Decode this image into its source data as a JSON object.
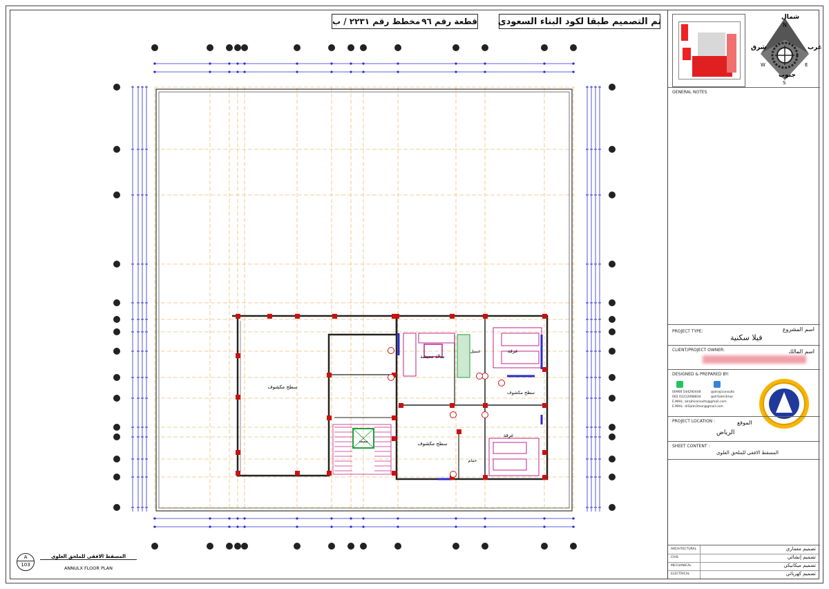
{
  "title_bar": {
    "code_text": "تم التصميم طبقا لكود البناء السعودى",
    "plot_text": "قطعة رقم ٩٦",
    "scheme_text": "مخطط رقم ٢٢٣١ / ب"
  },
  "compass": {
    "north_ar": "شمال",
    "east_ar": "شرق",
    "west_ar": "غرب",
    "south_ar": "جنوب",
    "n": "N",
    "e": "E",
    "w": "W",
    "s": "S"
  },
  "panel": {
    "general_notes": "GENERAL NOTES",
    "project_type_label": "PROJECT TYPE:",
    "project_type_ar_label": "اسم المشروع",
    "project_type_value": "فيلا سكنية",
    "owner_label": "CLIENT/PROJECT OWNER:",
    "owner_ar_label": "اسم المالك",
    "designed_label": "DESIGNED & PREPARED BY:",
    "contacts": [
      "00966 544292448",
      "002 01212068834",
      "E.MAIL: alrajhiconsults@gmail.com",
      "E.MAIL: drSalm3mar@gmail.com"
    ],
    "socials": [
      "@alrajiconsults",
      "@drSalm3mar"
    ],
    "location_label": "PROJECT LOCATION :",
    "location_ar_label": "الموقع",
    "location_value": "الرياض",
    "sheet_label": "SHEET CONTENT :",
    "sheet_value": "المسقط الافقى للملحق العلوى",
    "disciplines": [
      {
        "en": "ARCHITECTURAL",
        "ar": "تصميم معماري"
      },
      {
        "en": "CIVIL",
        "ar": "تصميم إنشائي"
      },
      {
        "en": "MECHANICAL",
        "ar": "تصميم ميكانيكي"
      },
      {
        "en": "ELECTRICAL",
        "ar": "تصميم كهربائي"
      }
    ]
  },
  "plan_rooms": {
    "open_roof_large": "سطح مكشوف",
    "living": "صالة معيشة",
    "open_roof_center": "سطح مكشوف",
    "room_top": "غرفة",
    "room_bottom": "غرفة",
    "open_roof_right": "سطح مكشوف",
    "laundry": "غسيل",
    "bath": "حمام",
    "elevator": "مصعد"
  },
  "sheet_label": {
    "number_letter": "A",
    "number": "103",
    "title_ar": "المسقط الافقى للملحق العلوى",
    "title_en": "ANNULX FLOOR PLAN"
  },
  "colors": {
    "grid": "#e8c27a",
    "dim_blue": "#2a2ad0",
    "wall_red": "#cc1010",
    "furniture": "#c0208a",
    "green": "#20a040"
  }
}
